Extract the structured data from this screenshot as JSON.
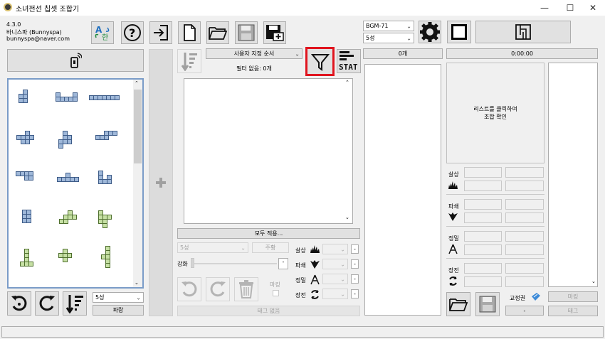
{
  "window": {
    "title": "소녀전선 칩셋 조합기",
    "minimize": "—",
    "maximize": "☐",
    "close": "✕"
  },
  "info": {
    "version": "4.3.0",
    "author": "바니스파 (Bunnyspa)",
    "email": "bunnyspa@naver.com"
  },
  "toolbar": {
    "bgm_select": "BGM-71",
    "star_select": "5성"
  },
  "left": {
    "star_select": "5성",
    "color_button": "파랑"
  },
  "middle": {
    "sort_select": "사용자 지정 순서",
    "filter_status": "필터 없음: 0개",
    "apply_all": "모두 적용...",
    "star_select": "5성",
    "color_button": "주황",
    "enhance_label": "강화",
    "enhance_value": "-",
    "mark_label": "마킹",
    "stat_dmg": "살상",
    "stat_brk": "파쇄",
    "stat_hit": "정밀",
    "stat_rld": "장전",
    "tag_none": "태그 없음",
    "minus": "-",
    "stat_icon_label": "STAT"
  },
  "right": {
    "count": "0개",
    "time": "0:00:00",
    "hint": "리스트를 클릭하여\n조합 확인",
    "stat_dmg": "살상",
    "stat_brk": "파쇄",
    "stat_hit": "정밀",
    "stat_rld": "장전",
    "ticket_label": "교정권",
    "ticket_value": "-",
    "mark_button": "마킹",
    "tag_button": "태그"
  },
  "colors": {
    "accent_red": "#e0141e",
    "chip_blue": "#9fb8d9",
    "chip_green": "#c6e0a4"
  }
}
